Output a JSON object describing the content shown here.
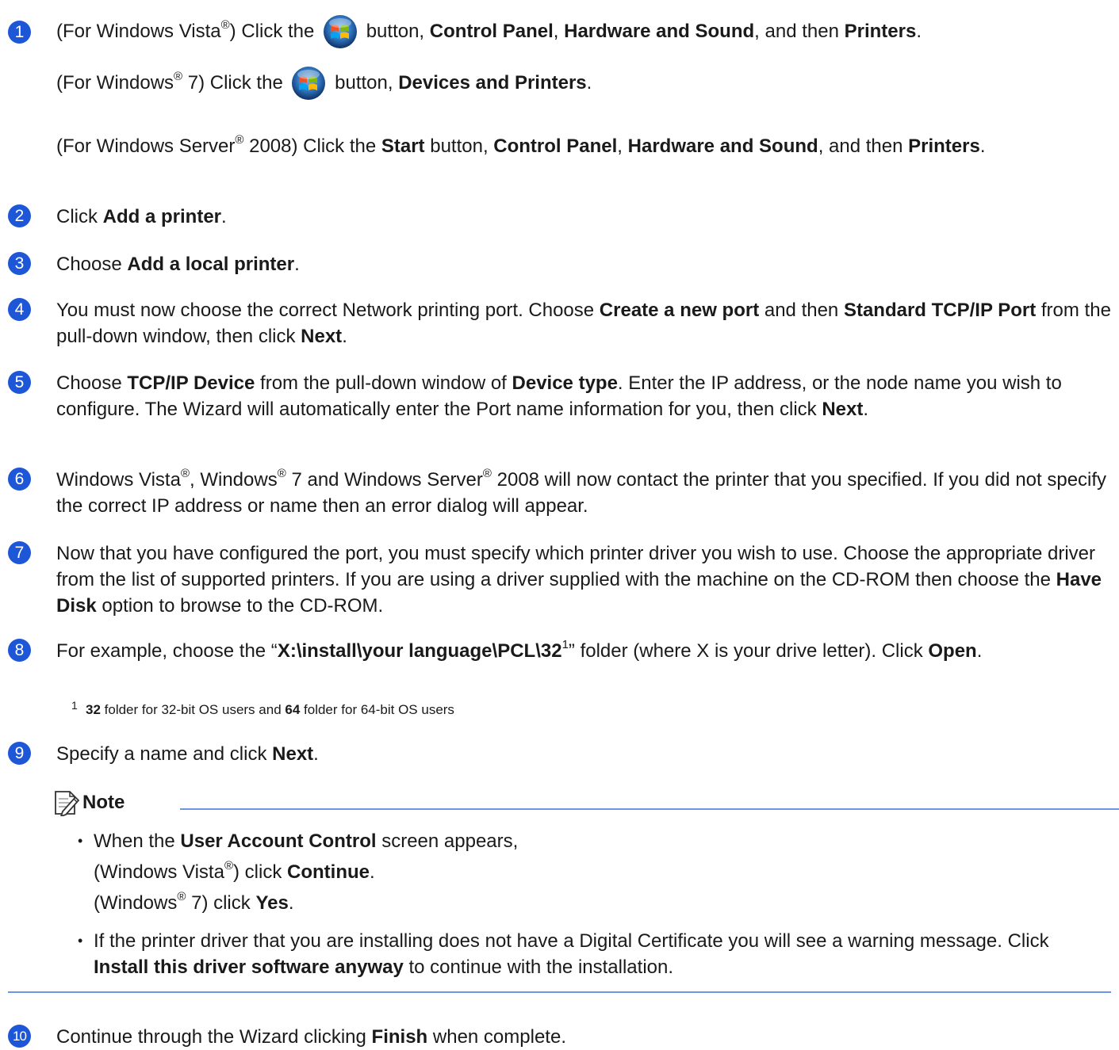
{
  "steps": [
    {
      "num": "1",
      "lines": {
        "a1": "(For Windows Vista",
        "a2": ") Click the ",
        "a3": " button, ",
        "a4": "Control Panel",
        "a5": ", ",
        "a6": "Hardware and Sound",
        "a7": ", and then ",
        "a8": "Printers",
        "a9": ".",
        "b1": "(For Windows",
        "b2": " 7)  Click the ",
        "b3": " button, ",
        "b4": "Devices and Printers",
        "b5": ".",
        "c1": "(For Windows Server",
        "c2": " 2008) Click the ",
        "c3": "Start",
        "c4": " button, ",
        "c5": "Control Panel",
        "c6": ", ",
        "c7": "Hardware and Sound",
        "c8": ", and then ",
        "c9": "Printers",
        "c10": "."
      }
    },
    {
      "num": "2",
      "t1": "Click ",
      "t2": "Add a printer",
      "t3": "."
    },
    {
      "num": "3",
      "t1": "Choose ",
      "t2": "Add a local printer",
      "t3": "."
    },
    {
      "num": "4",
      "t1": "You must now choose the correct Network printing port. Choose ",
      "t2": "Create a new port",
      "t3": " and then ",
      "t4": "Standard TCP/IP Port",
      "t5": " from the pull-down window, then click ",
      "t6": "Next",
      "t7": "."
    },
    {
      "num": "5",
      "t1": "Choose ",
      "t2": "TCP/IP Device",
      "t3": " from the pull-down window of ",
      "t4": "Device type",
      "t5": ". Enter the IP address, or the node name you wish to configure. The Wizard will automatically enter the Port name information for you, then click ",
      "t6": "Next",
      "t7": "."
    },
    {
      "num": "6",
      "t1": "Windows Vista",
      "t2": ", Windows",
      "t3": " 7 and Windows Server",
      "t4": " 2008 will now contact the printer that you specified. If you did not specify the correct IP address or name then an error dialog will appear."
    },
    {
      "num": "7",
      "t1": "Now that you have configured the port, you must specify which printer driver you wish to use. Choose the appropriate driver from the list of supported printers. If you are using a driver supplied with the machine on the CD-ROM then choose the ",
      "t2": "Have Disk",
      "t3": " option to browse to the CD-ROM."
    },
    {
      "num": "8",
      "t1": "For example, choose the “",
      "t2": "X:\\install\\your language\\PCL\\32",
      "t3": "1",
      "t4": "” folder (where X is your drive letter). Click ",
      "t5": "Open",
      "t6": "."
    },
    {
      "num": "9",
      "t1": "Specify a name and click ",
      "t2": "Next",
      "t3": "."
    },
    {
      "num": "10",
      "t1": "Continue through the Wizard clicking ",
      "t2": "Finish",
      "t3": " when complete."
    }
  ],
  "reg": "®",
  "footnote": {
    "num": "1",
    "b1": "32",
    "t1": " folder for 32-bit OS users and ",
    "b2": "64",
    "t2": " folder for 64-bit OS users"
  },
  "note": {
    "title": "Note",
    "bullets": [
      {
        "t1": "When the ",
        "t2": "User Account Control",
        "t3": " screen appears,",
        "l2a": "(Windows Vista",
        "l2b": ") click ",
        "l2c": "Continue",
        "l2d": ".",
        "l3a": "(Windows",
        "l3b": " 7) click ",
        "l3c": "Yes",
        "l3d": "."
      },
      {
        "t1": "If the printer driver that you are installing does not have a Digital Certificate you will see a warning message. Click ",
        "t2": "Install this driver software anyway",
        "t3": " to continue with the installation."
      }
    ]
  },
  "colors": {
    "accent": "#1e56d8",
    "rule": "#6d95e0"
  }
}
